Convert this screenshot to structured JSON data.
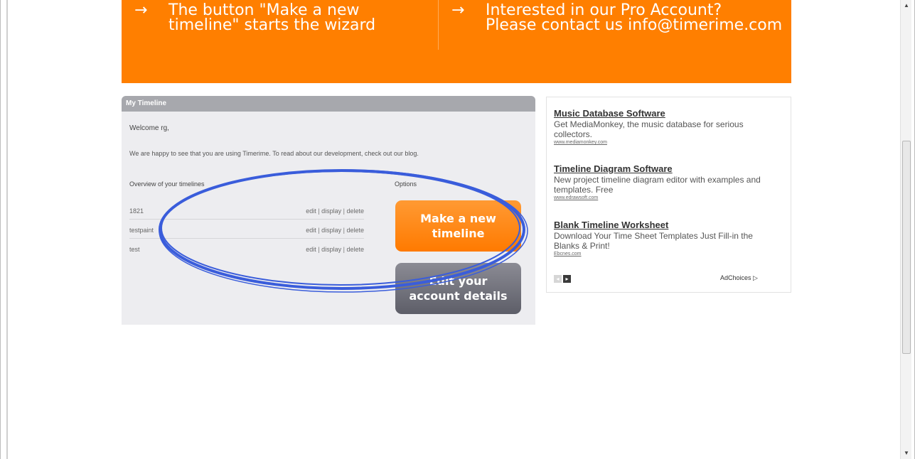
{
  "banner": {
    "item1_arrow": "→",
    "item1_line1": "The button \"Make a new",
    "item1_line2": "timeline\" starts the wizard",
    "item2_arrow": "→",
    "item2_line1": "Interested in our Pro Account?",
    "item2_line2": "Please contact us info@timerime.com"
  },
  "panel": {
    "header": "My Timeline",
    "welcome": "Welcome rg,",
    "intro": "We are happy to see that you are using Timerime. To read about our development, check out our blog.",
    "overview_label": "Overview of your timelines",
    "options_label": "Options",
    "timelines": [
      {
        "name": "1821",
        "edit": "edit",
        "display": "display",
        "delete": "delete"
      },
      {
        "name": "testpaint",
        "edit": "edit",
        "display": "display",
        "delete": "delete"
      },
      {
        "name": "test",
        "edit": "edit",
        "display": "display",
        "delete": "delete"
      }
    ],
    "separator": "|",
    "new_timeline_line1": "Make a new",
    "new_timeline_line2": "timeline",
    "edit_account_line1": "Edit your",
    "edit_account_line2": "account details"
  },
  "ads": {
    "items": [
      {
        "title": "Music Database Software",
        "body": "Get MediaMonkey, the music database for serious collectors.",
        "url": "www.mediamonkey.com"
      },
      {
        "title": "Timeline Diagram Software",
        "body": "New project timeline diagram editor with examples and templates. Free",
        "url": "www.edrawsoft.com"
      },
      {
        "title": "Blank Timeline Worksheet",
        "body": "Download Your Time Sheet Templates Just Fill-in the Blanks & Print!",
        "url": "Ebcnes.com"
      }
    ],
    "prev_icon": "◂",
    "next_icon": "▸",
    "choices_label": "AdChoices ▷"
  },
  "scrollbar": {
    "up_icon": "▲",
    "down_icon": "▼"
  },
  "colors": {
    "banner_orange": "#ff7f00",
    "button_orange": "#ff8a1a",
    "button_gray": "#6e6f78",
    "annotation_blue": "#3a5ddb"
  }
}
